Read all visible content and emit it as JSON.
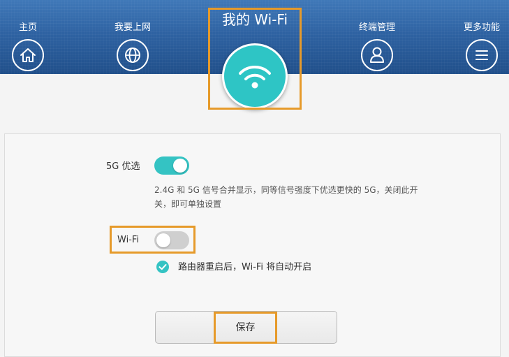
{
  "header": {
    "nav": [
      {
        "label": "主页",
        "icon": "home-icon"
      },
      {
        "label": "我要上网",
        "icon": "globe-icon"
      },
      {
        "label": "终端管理",
        "icon": "user-icon"
      },
      {
        "label": "更多功能",
        "icon": "menu-icon"
      }
    ],
    "active": {
      "label": "我的 Wi-Fi",
      "icon": "wifi-icon"
    }
  },
  "settings": {
    "band_5g_label": "5G 优选",
    "band_5g_enabled": true,
    "band_5g_description": "2.4G 和 5G 信号合并显示，同等信号强度下优选更快的 5G，关闭此开关，即可单独设置",
    "wifi_label": "Wi-Fi",
    "wifi_enabled": false,
    "auto_restart_checked": true,
    "auto_restart_label": "路由器重启后，Wi-Fi 将自动开启"
  },
  "actions": {
    "save_label": "保存"
  },
  "colors": {
    "header": "#2e62a2",
    "accent": "#34c3c3",
    "highlight": "#e69a2a"
  }
}
